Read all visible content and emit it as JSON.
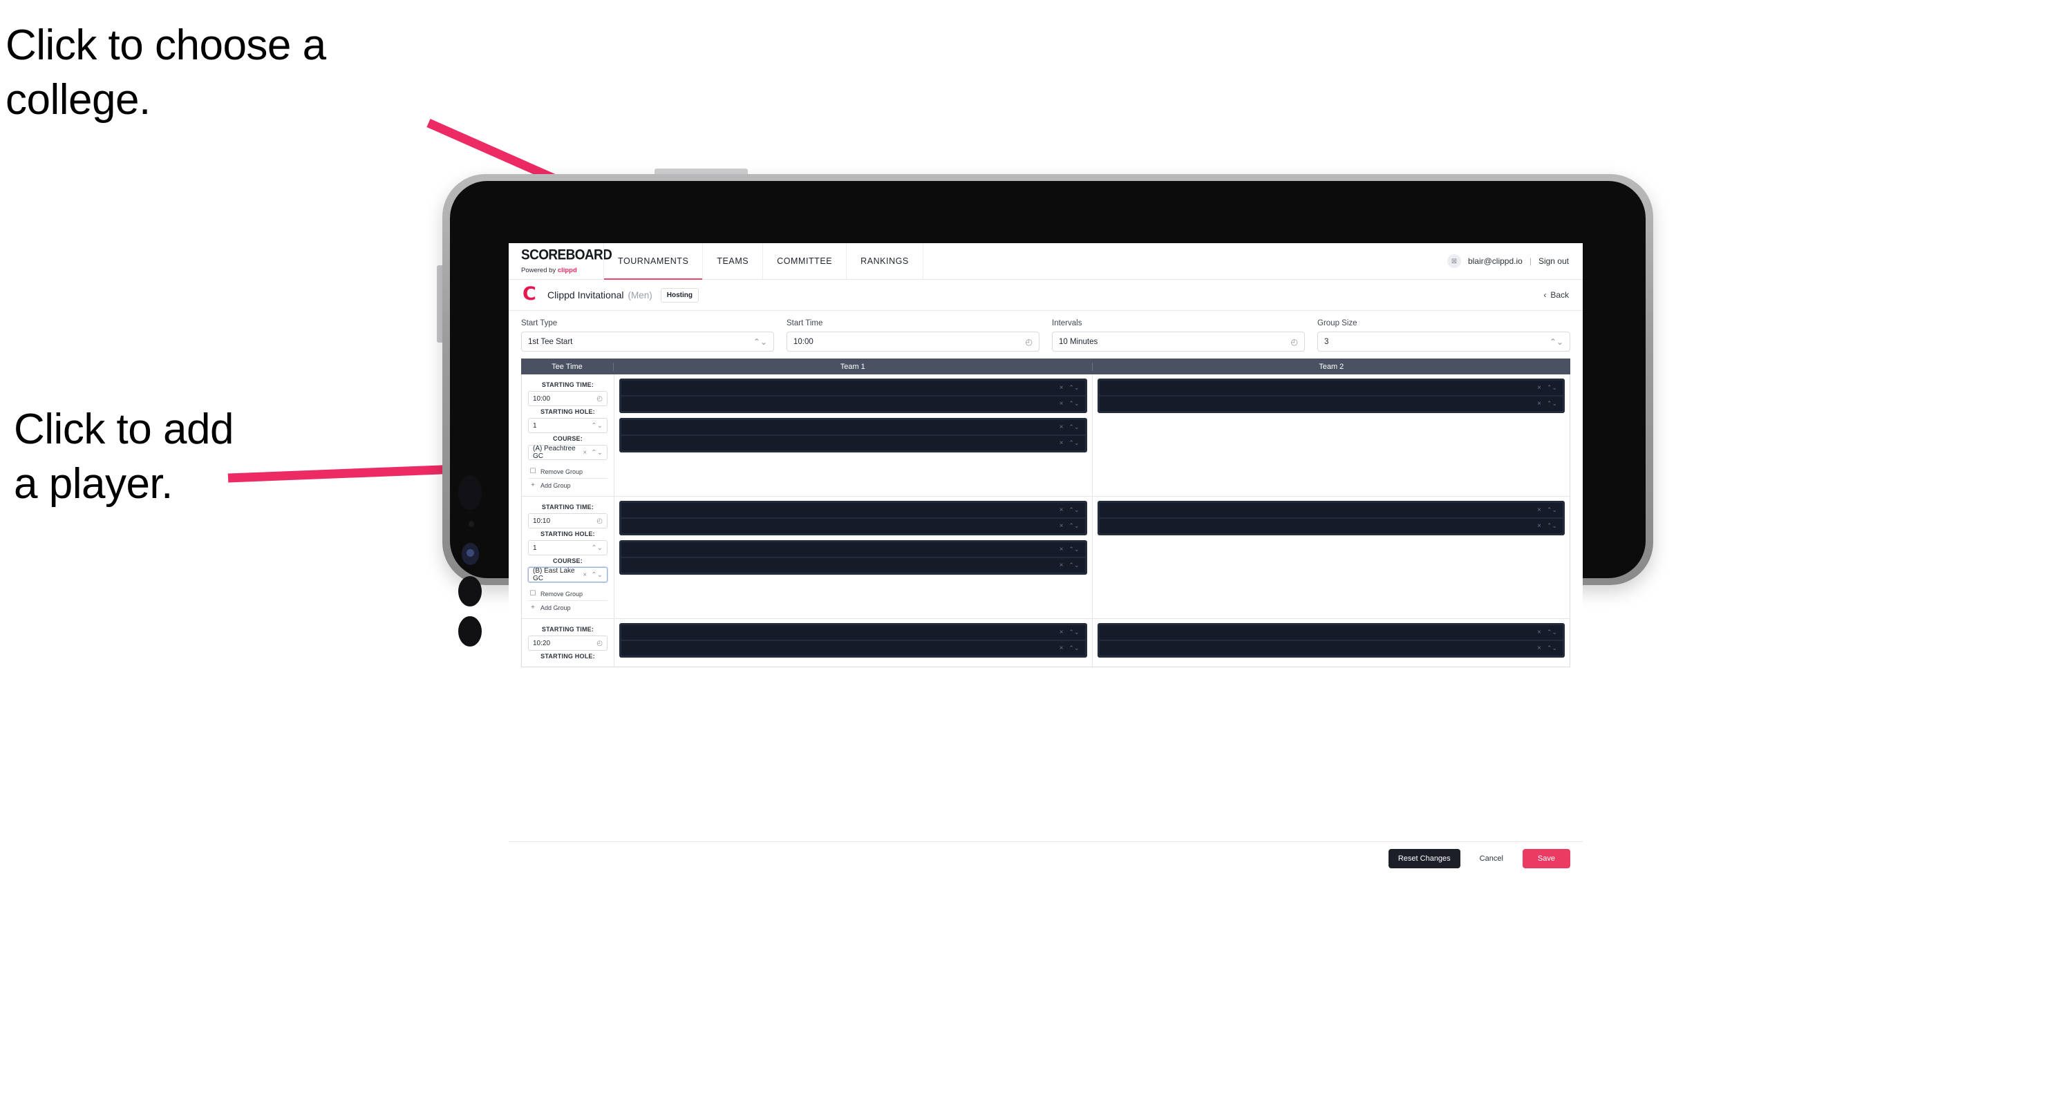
{
  "annotations": {
    "college": "Click to choose a\ncollege.",
    "player": "Click to add\na player.",
    "arrow_color": "#ec2a63"
  },
  "app": {
    "brand": {
      "title": "SCOREBOARD",
      "powered_prefix": "Powered by ",
      "powered_brand": "clippd"
    },
    "nav_tabs": [
      {
        "label": "TOURNAMENTS",
        "active": true
      },
      {
        "label": "TEAMS",
        "active": false
      },
      {
        "label": "COMMITTEE",
        "active": false
      },
      {
        "label": "RANKINGS",
        "active": false
      }
    ],
    "account": {
      "avatar_glyph": "⊠",
      "email": "blair@clippd.io",
      "separator": "|",
      "sign_out": "Sign out"
    },
    "subheader": {
      "logo_letter": "C",
      "tournament_name": "Clippd Invitational",
      "gender": "(Men)",
      "role_badge": "Hosting",
      "back_chevron": "‹",
      "back_label": "Back"
    },
    "form": {
      "start_type": {
        "label": "Start Type",
        "value": "1st Tee Start",
        "icon": "⌃⌄"
      },
      "start_time": {
        "label": "Start Time",
        "value": "10:00",
        "icon": "◴"
      },
      "intervals": {
        "label": "Intervals",
        "value": "10 Minutes",
        "icon": "◴"
      },
      "group_size": {
        "label": "Group Size",
        "value": "3",
        "icon": "⌃⌄"
      }
    },
    "table": {
      "headers": {
        "tee_time": "Tee Time",
        "team1": "Team 1",
        "team2": "Team 2"
      },
      "field_labels": {
        "starting_time": "STARTING TIME:",
        "starting_hole": "STARTING HOLE:",
        "course": "COURSE:"
      },
      "group_actions": {
        "remove": "Remove Group",
        "add": "Add Group",
        "remove_icon": "Ὕ1",
        "add_icon": "+"
      },
      "row_icons": {
        "clear": "×",
        "stepper": "⌃⌄",
        "clock": "◴",
        "spinner": "⌃⌄"
      },
      "rows": [
        {
          "starting_time": "10:00",
          "starting_hole": "1",
          "course": "(A) Peachtree GC",
          "course_focused": false,
          "team1_groups": [
            {
              "players": 2
            },
            {
              "players": 2
            }
          ],
          "team2_groups": [
            {
              "players": 2
            }
          ]
        },
        {
          "starting_time": "10:10",
          "starting_hole": "1",
          "course": "(B) East Lake GC",
          "course_focused": true,
          "team1_groups": [
            {
              "players": 2
            },
            {
              "players": 2
            }
          ],
          "team2_groups": [
            {
              "players": 2
            }
          ]
        },
        {
          "starting_time": "10:20",
          "starting_hole": "",
          "course": "",
          "course_focused": false,
          "team1_groups": [
            {
              "players": 2
            }
          ],
          "team2_groups": [
            {
              "players": 2
            }
          ]
        }
      ]
    },
    "footer": {
      "reset": "Reset Changes",
      "cancel": "Cancel",
      "save": "Save"
    }
  },
  "colors": {
    "accent_pink": "#ec3b63",
    "header_slate": "#4a5163",
    "player_block": "#232a3a",
    "player_row": "#151b29"
  }
}
